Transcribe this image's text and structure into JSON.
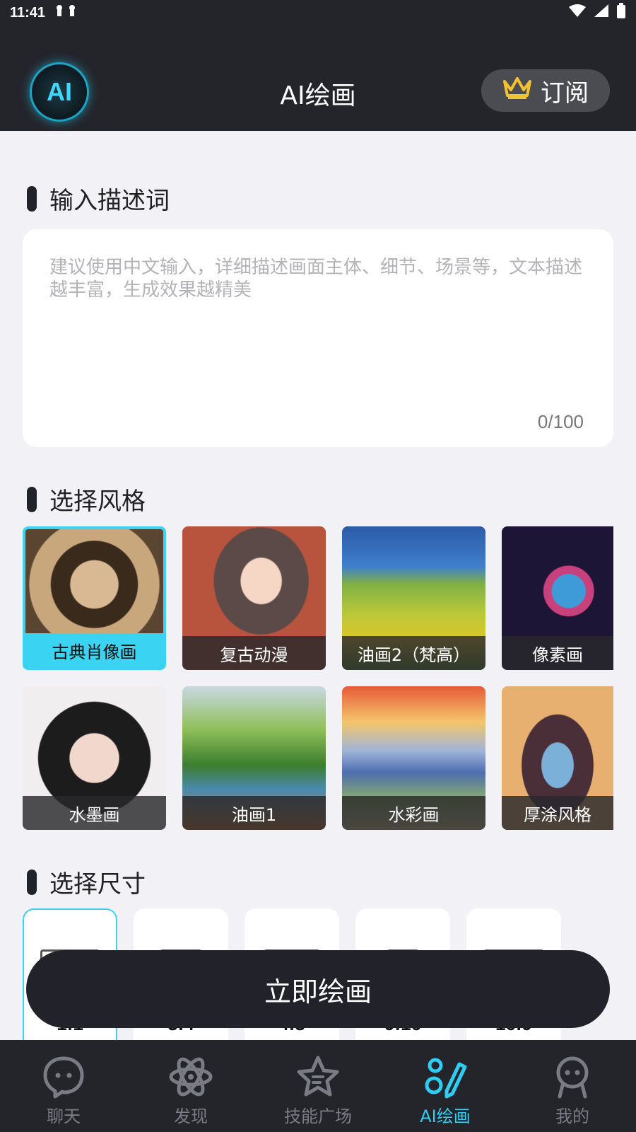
{
  "status_bar": {
    "time": "11:41"
  },
  "header": {
    "logo_text": "AI",
    "title": "AI绘画",
    "subscribe_label": "订阅"
  },
  "description": {
    "section_title": "输入描述词",
    "placeholder": "建议使用中文输入，详细描述画面主体、细节、场景等，文本描述越丰富，生成效果越精美",
    "counter": "0/100"
  },
  "styles": {
    "section_title": "选择风格",
    "items": [
      {
        "label": "古典肖像画",
        "selected": true
      },
      {
        "label": "复古动漫",
        "selected": false
      },
      {
        "label": "油画2（梵高）",
        "selected": false
      },
      {
        "label": "像素画",
        "selected": false
      },
      {
        "label": "水墨画",
        "selected": false
      },
      {
        "label": "油画1",
        "selected": false
      },
      {
        "label": "水彩画",
        "selected": false
      },
      {
        "label": "厚涂风格",
        "selected": false
      }
    ]
  },
  "sizes": {
    "section_title": "选择尺寸",
    "items": [
      {
        "ratio": "1:1",
        "selected": true
      },
      {
        "ratio": "3:4",
        "selected": false
      },
      {
        "ratio": "4:3",
        "selected": false
      },
      {
        "ratio": "9:16",
        "selected": false
      },
      {
        "ratio": "16:9",
        "selected": false
      }
    ]
  },
  "draw_button": {
    "label": "立即绘画"
  },
  "tabbar": {
    "items": [
      {
        "label": "聊天",
        "icon": "chat-face-icon",
        "active": false
      },
      {
        "label": "发现",
        "icon": "atom-icon",
        "active": false
      },
      {
        "label": "技能广场",
        "icon": "star-icon",
        "active": false
      },
      {
        "label": "AI绘画",
        "icon": "paint-pen-icon",
        "active": true
      },
      {
        "label": "我的",
        "icon": "person-face-icon",
        "active": false
      }
    ]
  },
  "colors": {
    "header_bg": "#24252b",
    "accent": "#3ad3f2",
    "page_bg": "#f1f1f6"
  }
}
